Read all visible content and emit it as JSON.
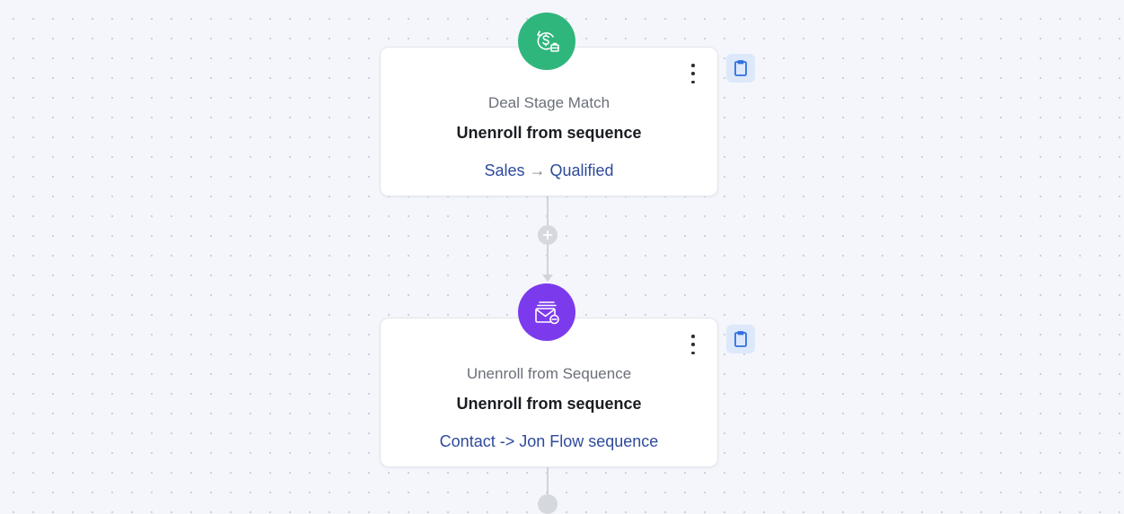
{
  "nodes": [
    {
      "subtitle": "Deal Stage Match",
      "title": "Unenroll from sequence",
      "detail_from": "Sales",
      "detail_arrow": "→",
      "detail_to": "Qualified",
      "icon": "deal-stage-icon",
      "icon_color": "#2fb67c"
    },
    {
      "subtitle": "Unenroll from Sequence",
      "title": "Unenroll from sequence",
      "detail": "Contact -> Jon Flow sequence",
      "icon": "unenroll-mail-icon",
      "icon_color": "#7c3aed"
    }
  ],
  "colors": {
    "background": "#f4f6fb",
    "link_text": "#2d4a9c",
    "clipboard_button_bg": "#dde8fb",
    "clipboard_icon": "#2f6fe0"
  }
}
